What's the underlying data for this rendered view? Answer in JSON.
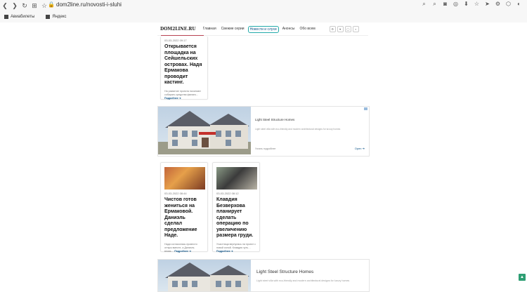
{
  "browser": {
    "url": "dom2line.ru/novosti-i-sluhi",
    "bookmarks": [
      {
        "label": "Авиабилеты"
      },
      {
        "label": "Яндекс"
      }
    ]
  },
  "site": {
    "logo_text": "DOM2LINE.RU",
    "nav": [
      {
        "label": "Главная"
      },
      {
        "label": "Свежие серии"
      },
      {
        "label": "Новости и слухи"
      },
      {
        "label": "Анонсы"
      },
      {
        "label": "Обо всем"
      }
    ]
  },
  "cards": [
    {
      "date": "03-03-2022 09:17",
      "title": "Открывается площадка на Сейшельских островах. Надя Ермакова проводит кастинг.",
      "excerpt": "На развитие проекта начинают собирать средства финанс...",
      "more": "Подробнее ➔"
    },
    {
      "date": "03-03-2022 08:44",
      "title": "Чистов готов жениться на Ермаковой. Даниэль сделал предложение Наде.",
      "excerpt": "Надя согласилась провести отпуск вместе, а Даниэль вновь…",
      "more": "Подробнее ➔"
    },
    {
      "date": "03-03-2022 08:12",
      "title": "Клавдия Безверхова планирует сделать операцию по увеличению размера груди.",
      "excerpt": "Участница вернулась на проект с новой силой. Клавдия чуть…",
      "more": "Подробнее ➔"
    }
  ],
  "ads": [
    {
      "title": "Light Steel Structure Homes",
      "desc": "Light steel villa with eco-friendly and modern architectural designs for luxury homes",
      "link": "Узнать подробнее",
      "button": "Open ➔"
    },
    {
      "title": "Light Steel Structure Homes",
      "desc": "Light steel villa with eco-friendly and modern architectural designs for luxury homes"
    }
  ]
}
